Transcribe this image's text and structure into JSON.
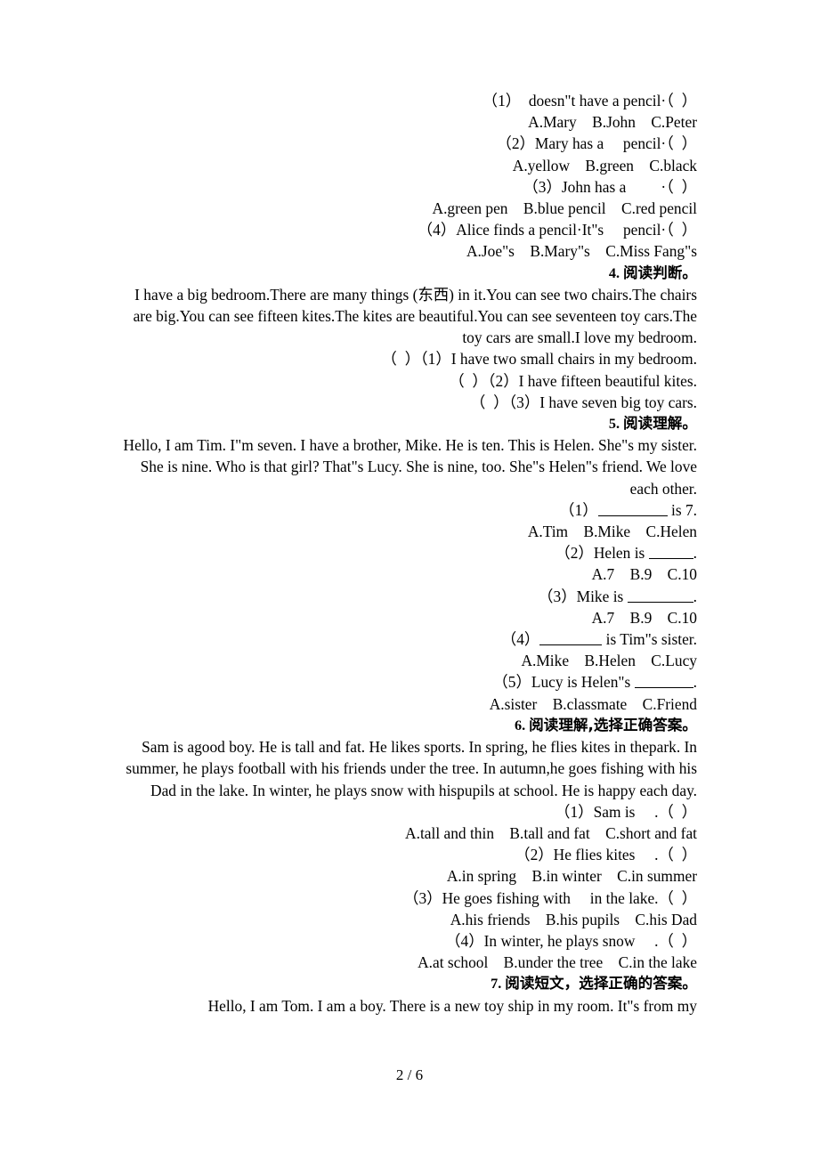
{
  "document": {
    "page_label": "2 / 6",
    "blocks": [
      {
        "kind": "question-line",
        "text": "（1）　doesn\"t have a pencil·（  ）"
      },
      {
        "kind": "options-line",
        "text": "A.Mary　B.John　C.Peter"
      },
      {
        "kind": "question-line",
        "text": "（2）Mary has a 　pencil·（  ）"
      },
      {
        "kind": "options-line",
        "text": "A.yellow　B.green　C.black"
      },
      {
        "kind": "question-line",
        "text": "（3）John has a 　　·（  ）"
      },
      {
        "kind": "options-line",
        "text": "A.green pen　B.blue pencil　C.red pencil"
      },
      {
        "kind": "question-line",
        "text": "（4）Alice finds a pencil·It\"s 　pencil·（  ）"
      },
      {
        "kind": "options-line",
        "text": "A.Joe\"s　B.Mary\"s　C.Miss Fang\"s"
      },
      {
        "kind": "heading",
        "number": "4. ",
        "cn": "阅读判断。"
      },
      {
        "kind": "passage",
        "text": "I have a big bedroom.There are many things (东西) in it.You can see two chairs.The chairs are big.You can see fifteen kites.The kites are beautiful.You can see seventeen toy cars.The toy cars are small.I love my bedroom."
      },
      {
        "kind": "question-line",
        "text": "（  ）（1）I have two small chairs in my bedroom."
      },
      {
        "kind": "question-line",
        "text": "（  ）（2）I have fifteen beautiful kites."
      },
      {
        "kind": "question-line",
        "text": "（  ）（3）I have seven big toy cars."
      },
      {
        "kind": "heading",
        "number": "5. ",
        "cn": "阅读理解。"
      },
      {
        "kind": "passage",
        "text": "Hello, I am Tim. I\"m seven. I have a brother, Mike. He is ten. This is Helen. She\"s my sister. She is nine. Who is that girl? That\"s Lucy. She is nine, too. She\"s Helen\"s friend. We love each other."
      },
      {
        "kind": "question-line-underline",
        "prefix": "（1）",
        "blank_width": 78,
        "suffix": " is 7."
      },
      {
        "kind": "options-line",
        "text": "A.Tim　B.Mike　C.Helen"
      },
      {
        "kind": "question-line-underline",
        "prefix": "（2）Helen is ",
        "blank_width": 50,
        "suffix": "."
      },
      {
        "kind": "options-line",
        "text": "A.7　B.9　C.10"
      },
      {
        "kind": "question-line-underline",
        "prefix": "（3）Mike is ",
        "blank_width": 74,
        "suffix": "."
      },
      {
        "kind": "options-line",
        "text": "A.7　B.9　C.10"
      },
      {
        "kind": "question-line-underline",
        "prefix": "（4）",
        "blank_width": 70,
        "suffix": " is Tim\"s sister."
      },
      {
        "kind": "options-line",
        "text": "A.Mike　B.Helen　C.Lucy"
      },
      {
        "kind": "question-line-underline",
        "prefix": "（5）Lucy is Helen\"s ",
        "blank_width": 66,
        "suffix": "."
      },
      {
        "kind": "options-line",
        "text": "A.sister　B.classmate　C.Friend"
      },
      {
        "kind": "heading",
        "number": "6. ",
        "cn": "阅读理解,选择正确答案。"
      },
      {
        "kind": "passage",
        "text": "Sam is agood boy. He is tall and fat. He likes sports. In spring, he flies kites in thepark. In summer, he plays football with his friends under the tree. In autumn,he goes fishing with his Dad in the lake. In winter, he plays snow with hispupils at school. He is happy each day."
      },
      {
        "kind": "question-line",
        "text": "（1）Sam is 　.（  ）"
      },
      {
        "kind": "options-line",
        "text": "A.tall and thin　B.tall and fat　C.short and fat"
      },
      {
        "kind": "question-line",
        "text": "（2）He flies kites 　.（  ）"
      },
      {
        "kind": "options-line",
        "text": "A.in spring　B.in winter　C.in summer"
      },
      {
        "kind": "question-line",
        "text": "（3）He goes fishing with 　in the lake.（  ）"
      },
      {
        "kind": "options-line",
        "text": "A.his friends　B.his pupils　C.his Dad"
      },
      {
        "kind": "question-line",
        "text": "（4）In winter, he plays snow 　.（  ）"
      },
      {
        "kind": "options-line",
        "text": "A.at school　B.under the tree　C.in the lake"
      },
      {
        "kind": "heading",
        "number": "7. ",
        "cn": "阅读短文，选择正确的答案。"
      },
      {
        "kind": "passage",
        "text": "Hello, I am Tom. I am a boy. There is a new toy ship in my room. It\"s from my"
      }
    ]
  }
}
